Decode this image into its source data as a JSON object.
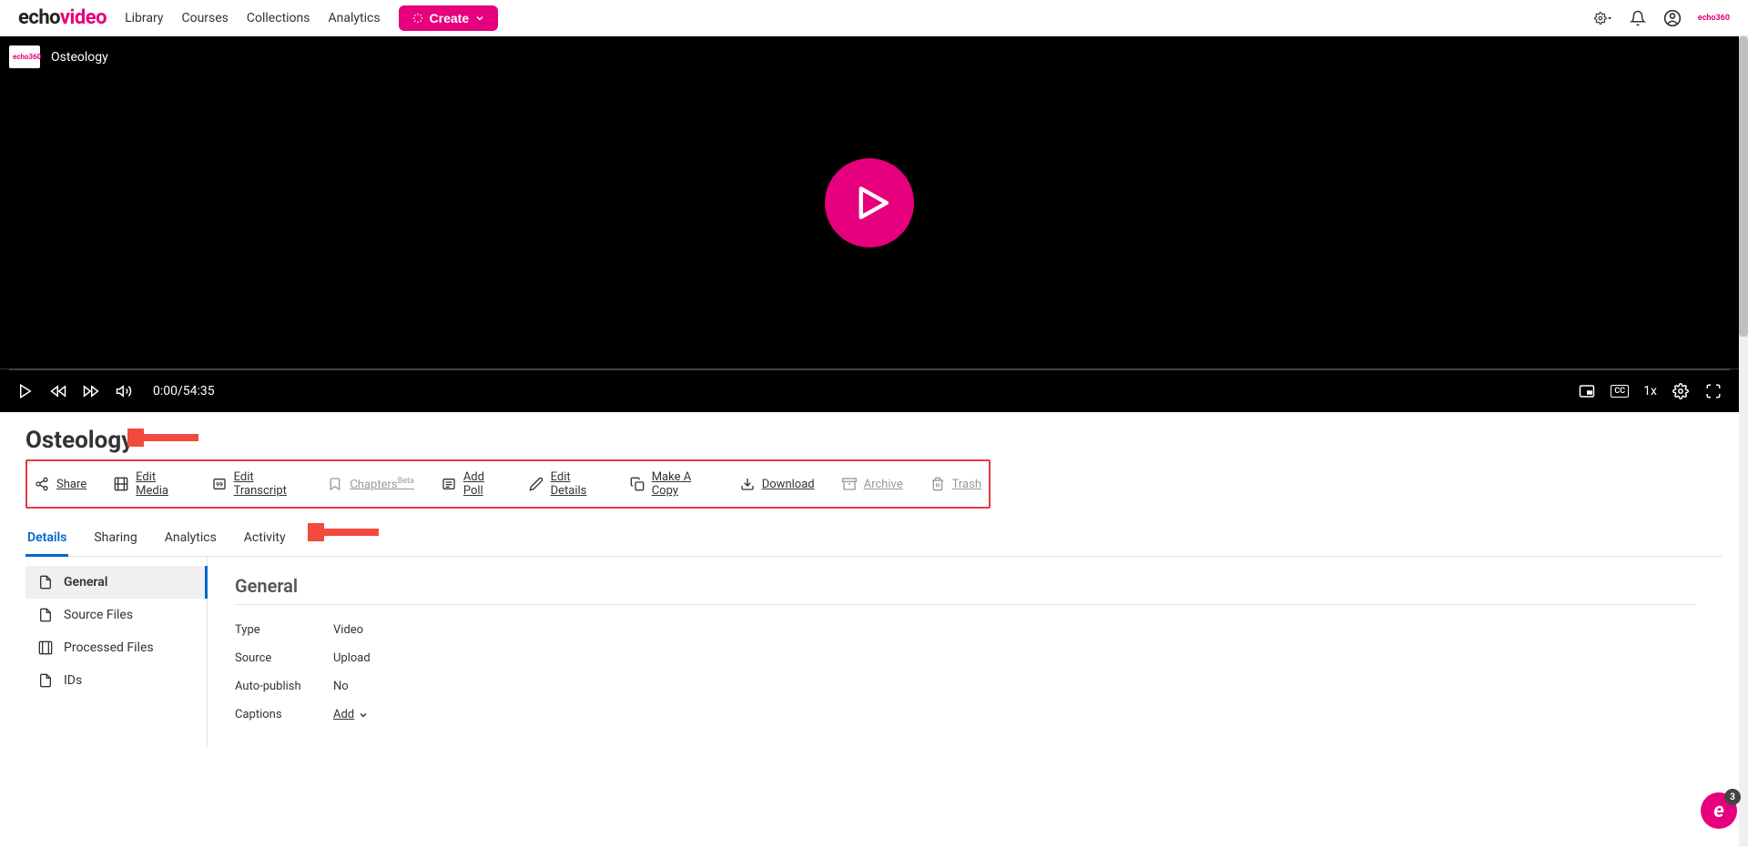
{
  "logo": {
    "part1": "echo",
    "part2": "video"
  },
  "nav": {
    "library": "Library",
    "courses": "Courses",
    "collections": "Collections",
    "analytics": "Analytics"
  },
  "create_btn": "Create",
  "small_logo": "echo360",
  "video": {
    "title_top": "Osteology",
    "badge": "echo360",
    "time": "0:00/54:35",
    "speed": "1x",
    "cc": "CC"
  },
  "page_title": "Osteology",
  "actions": {
    "share": "Share",
    "edit_media": "Edit Media",
    "edit_transcript": "Edit Transcript",
    "chapters": "Chapters",
    "chapters_beta": "Beta",
    "add_poll": "Add Poll",
    "edit_details": "Edit Details",
    "make_copy": "Make A Copy",
    "download": "Download",
    "archive": "Archive",
    "trash": "Trash"
  },
  "tabs": {
    "details": "Details",
    "sharing": "Sharing",
    "analytics": "Analytics",
    "activity": "Activity"
  },
  "sidebar": {
    "general": "General",
    "source_files": "Source Files",
    "processed_files": "Processed Files",
    "ids": "IDs"
  },
  "section_title": "General",
  "details": {
    "type_label": "Type",
    "type_value": "Video",
    "source_label": "Source",
    "source_value": "Upload",
    "autopub_label": "Auto-publish",
    "autopub_value": "No",
    "captions_label": "Captions",
    "captions_value": "Add"
  },
  "floating_badge": "3"
}
